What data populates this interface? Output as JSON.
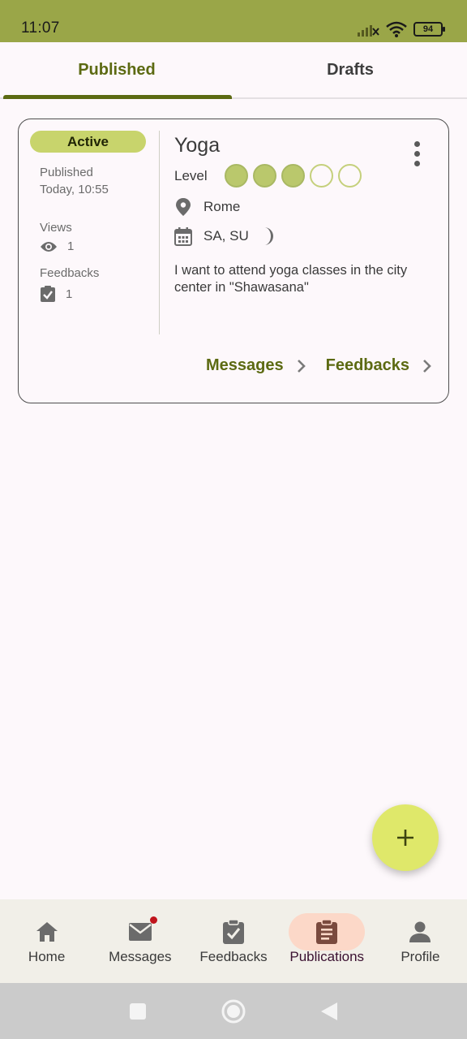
{
  "status_bar": {
    "time": "11:07",
    "battery": "94"
  },
  "tabs": [
    {
      "label": "Published",
      "active": true
    },
    {
      "label": "Drafts",
      "active": false
    }
  ],
  "card": {
    "status": "Active",
    "published_label": "Published",
    "published_value": "Today, 10:55",
    "views_label": "Views",
    "views_value": "1",
    "feedbacks_label": "Feedbacks",
    "feedbacks_value": "1",
    "title": "Yoga",
    "level_label": "Level",
    "level_value": 3,
    "level_max": 5,
    "location": "Rome",
    "days": "SA, SU",
    "description": "I want to attend yoga classes in the city center in \"Shawasana\"",
    "messages_action": "Messages",
    "feedbacks_action": "Feedbacks"
  },
  "bottom_nav": [
    {
      "label": "Home",
      "icon": "home-icon"
    },
    {
      "label": "Messages",
      "icon": "mail-icon",
      "has_notification": true
    },
    {
      "label": "Feedbacks",
      "icon": "clipboard-check-icon"
    },
    {
      "label": "Publications",
      "icon": "clipboard-text-icon",
      "active": true
    },
    {
      "label": "Profile",
      "icon": "person-icon"
    }
  ],
  "colors": {
    "accent": "#5c6a12",
    "status_bar": "#9aa648",
    "badge": "#c8d46c",
    "fab": "#dfe86a",
    "nav_active": "#fcd8c8",
    "notification": "#c0141c"
  }
}
